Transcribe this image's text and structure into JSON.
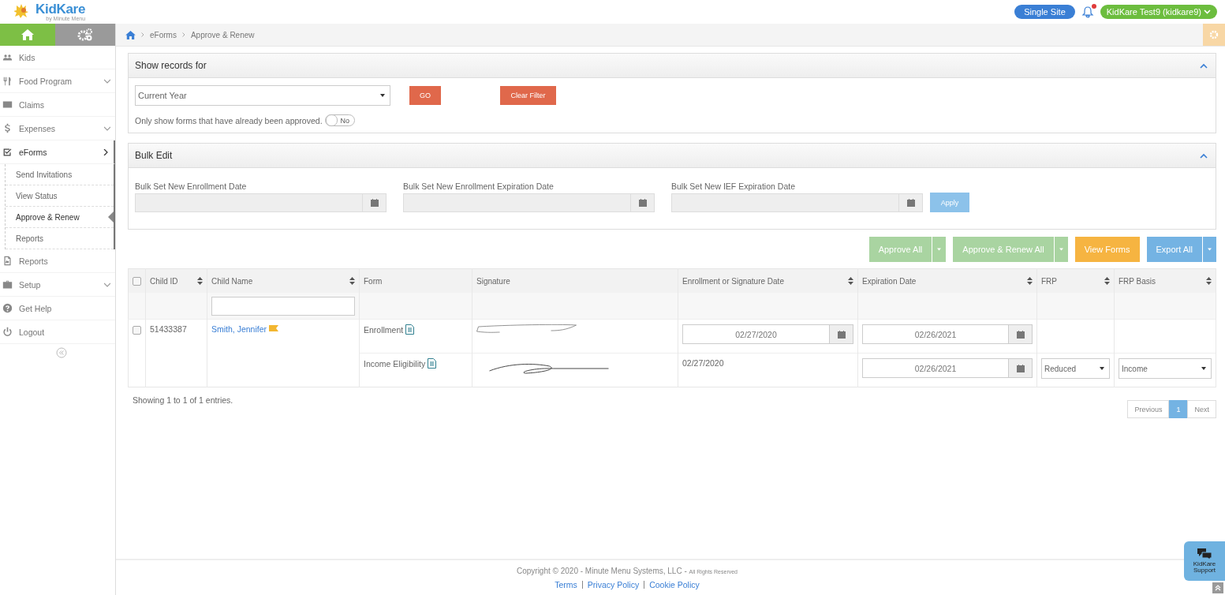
{
  "logo": {
    "text": "KidKare",
    "tagline": "by Minute Menu"
  },
  "header": {
    "site_button": "Single Site",
    "has_notifications": true,
    "user_menu": "KidKare Test9 (kidkare9)"
  },
  "sidebar": {
    "items": [
      {
        "label": "Kids"
      },
      {
        "label": "Food Program",
        "expanded": false
      },
      {
        "label": "Claims"
      },
      {
        "label": "Expenses",
        "expanded": false
      },
      {
        "label": "eForms",
        "expanded": true,
        "children": [
          {
            "label": "Send Invitations",
            "selected": false
          },
          {
            "label": "View Status",
            "selected": false
          },
          {
            "label": "Approve & Renew",
            "selected": true
          },
          {
            "label": "Reports",
            "selected": false
          }
        ]
      },
      {
        "label": "Reports"
      },
      {
        "label": "Setup",
        "expanded": false
      },
      {
        "label": "Get Help"
      },
      {
        "label": "Logout"
      }
    ]
  },
  "breadcrumb": [
    "eForms",
    "Approve & Renew"
  ],
  "filter_panel": {
    "title": "Show records for",
    "period": "Current Year",
    "go_button": "GO",
    "clear_button": "Clear Filter",
    "approved_only_label": "Only show forms that have already been approved.",
    "approved_only": {
      "on": false,
      "label": "No"
    }
  },
  "bulk_edit": {
    "title": "Bulk Edit",
    "fields": [
      "Bulk Set New Enrollment Date",
      "Bulk Set New Enrollment Expiration Date",
      "Bulk Set New IEF Expiration Date"
    ],
    "apply_button": "Apply"
  },
  "actions": [
    {
      "label": "Approve All",
      "split": true,
      "color": "#a9d4a1"
    },
    {
      "label": "Approve & Renew All",
      "split": true,
      "color": "#a9d4a1"
    },
    {
      "label": "View Forms",
      "split": false,
      "color": "#f6b441"
    },
    {
      "label": "Export All",
      "split": true,
      "color": "#74b3e3"
    }
  ],
  "table": {
    "select_all_checked": false,
    "columns": [
      {
        "label": "Child ID",
        "sortable": true
      },
      {
        "label": "Child Name",
        "sortable": true
      },
      {
        "label": "Form",
        "sortable": false
      },
      {
        "label": "Signature",
        "sortable": false
      },
      {
        "label": "Enrollment or Signature Date",
        "sortable": true
      },
      {
        "label": "Expiration Date",
        "sortable": true
      },
      {
        "label": "FRP",
        "sortable": true
      },
      {
        "label": "FRP Basis",
        "sortable": true
      }
    ],
    "rows": [
      {
        "checked": false,
        "child_id": "51433387",
        "child_name": "Smith, Jennifer",
        "flagged": true,
        "forms": [
          {
            "form": "Enrollment",
            "enrollment_date": {
              "kind": "input",
              "value": "02/27/2020"
            },
            "expiration_date": "02/26/2021"
          },
          {
            "form": "Income Eligibility",
            "enrollment_date": {
              "kind": "text",
              "value": "02/27/2020"
            },
            "expiration_date": "02/26/2021",
            "frp": "Reduced",
            "frp_basis": "Income"
          }
        ]
      }
    ]
  },
  "info": "Showing 1 to 1 of 1 entries.",
  "pagination": {
    "previous": "Previous",
    "pages": [
      {
        "label": "1",
        "selected": true
      }
    ],
    "next": "Next"
  },
  "footer": {
    "copyright": "Copyright © 2020 - Minute Menu Systems, LLC -",
    "rights": "All Rights Reserved",
    "links": [
      "Terms",
      "Privacy Policy",
      "Cookie Policy"
    ]
  },
  "support_button": "KidKare Support"
}
